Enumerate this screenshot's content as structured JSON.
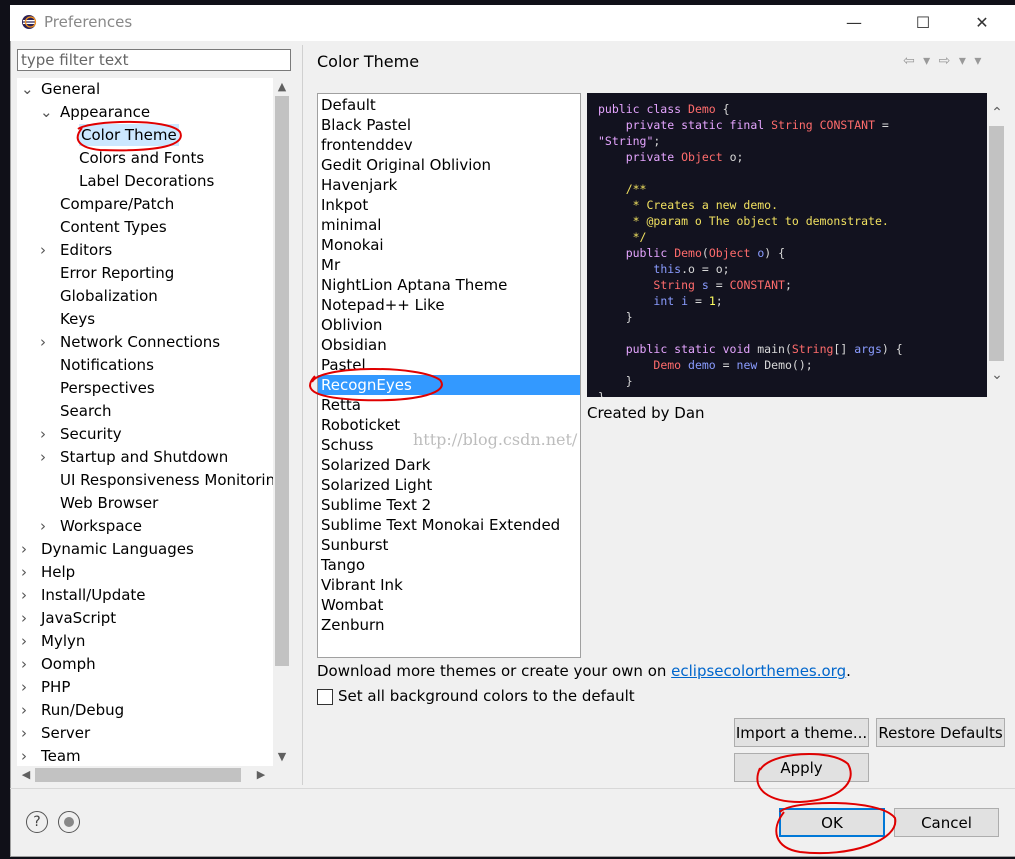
{
  "window": {
    "title": "Preferences",
    "controls": {
      "minimize": "—",
      "maximize": "☐",
      "close": "✕"
    }
  },
  "filter": {
    "placeholder": "type filter text",
    "value": ""
  },
  "tree": [
    {
      "label": "General",
      "level": 0,
      "twisty": "expanded"
    },
    {
      "label": "Appearance",
      "level": 1,
      "twisty": "expanded"
    },
    {
      "label": "Color Theme",
      "level": 2,
      "twisty": "none",
      "selected": true
    },
    {
      "label": "Colors and Fonts",
      "level": 2,
      "twisty": "none"
    },
    {
      "label": "Label Decorations",
      "level": 2,
      "twisty": "none"
    },
    {
      "label": "Compare/Patch",
      "level": 1,
      "twisty": "none"
    },
    {
      "label": "Content Types",
      "level": 1,
      "twisty": "none"
    },
    {
      "label": "Editors",
      "level": 1,
      "twisty": "collapsed"
    },
    {
      "label": "Error Reporting",
      "level": 1,
      "twisty": "none"
    },
    {
      "label": "Globalization",
      "level": 1,
      "twisty": "none"
    },
    {
      "label": "Keys",
      "level": 1,
      "twisty": "none"
    },
    {
      "label": "Network Connections",
      "level": 1,
      "twisty": "collapsed"
    },
    {
      "label": "Notifications",
      "level": 1,
      "twisty": "none"
    },
    {
      "label": "Perspectives",
      "level": 1,
      "twisty": "none"
    },
    {
      "label": "Search",
      "level": 1,
      "twisty": "none"
    },
    {
      "label": "Security",
      "level": 1,
      "twisty": "collapsed"
    },
    {
      "label": "Startup and Shutdown",
      "level": 1,
      "twisty": "collapsed"
    },
    {
      "label": "UI Responsiveness Monitorin",
      "level": 1,
      "twisty": "none"
    },
    {
      "label": "Web Browser",
      "level": 1,
      "twisty": "none"
    },
    {
      "label": "Workspace",
      "level": 1,
      "twisty": "collapsed"
    },
    {
      "label": "Dynamic Languages",
      "level": 0,
      "twisty": "collapsed"
    },
    {
      "label": "Help",
      "level": 0,
      "twisty": "collapsed"
    },
    {
      "label": "Install/Update",
      "level": 0,
      "twisty": "collapsed"
    },
    {
      "label": "JavaScript",
      "level": 0,
      "twisty": "collapsed"
    },
    {
      "label": "Mylyn",
      "level": 0,
      "twisty": "collapsed"
    },
    {
      "label": "Oomph",
      "level": 0,
      "twisty": "collapsed"
    },
    {
      "label": "PHP",
      "level": 0,
      "twisty": "collapsed"
    },
    {
      "label": "Run/Debug",
      "level": 0,
      "twisty": "collapsed"
    },
    {
      "label": "Server",
      "level": 0,
      "twisty": "collapsed"
    },
    {
      "label": "Team",
      "level": 0,
      "twisty": "collapsed"
    }
  ],
  "page": {
    "title": "Color Theme",
    "themes": [
      "Default",
      "Black Pastel",
      "frontenddev",
      "Gedit Original Oblivion",
      "Havenjark",
      "Inkpot",
      "minimal",
      "Monokai",
      "Mr",
      "NightLion Aptana Theme",
      "Notepad++ Like",
      "Oblivion",
      "Obsidian",
      "Pastel",
      "RecognEyes",
      "Retta",
      "Roboticket",
      "Schuss",
      "Solarized Dark",
      "Solarized Light",
      "Sublime Text 2",
      "Sublime Text Monokai Extended",
      "Sunburst",
      "Tango",
      "Vibrant Ink",
      "Wombat",
      "Zenburn"
    ],
    "selected_theme": "RecognEyes",
    "credit": "Created by Dan",
    "watermark": "http://blog.csdn.net/",
    "download_prefix": "Download more themes or create your own on ",
    "download_link": "eclipsecolorthemes.org",
    "download_suffix": ".",
    "checkbox_label": "Set all background colors to the default",
    "checkbox_checked": false
  },
  "buttons": {
    "import": "Import a theme...",
    "restore": "Restore Defaults",
    "apply": "Apply",
    "ok": "OK",
    "cancel": "Cancel"
  },
  "icons": {
    "help": "?",
    "nav": "⇦ ▾ ⇨ ▾ ▾"
  },
  "colors": {
    "selection": "#3399ff",
    "preview_bg": "#12121f",
    "annotation": "#e00000",
    "link": "#0066cc"
  }
}
